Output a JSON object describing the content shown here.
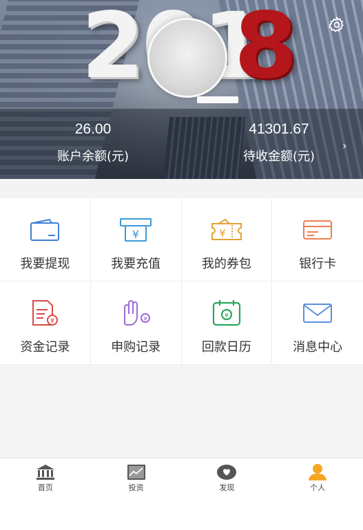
{
  "banner": {
    "year_text": "201",
    "year_accent": "8"
  },
  "account": {
    "balance_value": "26.00",
    "balance_label": "账户余额(元)",
    "pending_value": "41301.67",
    "pending_label": "待收金额(元)"
  },
  "menu": [
    {
      "label": "我要提现",
      "icon": "wallet-icon",
      "color": "#3d7fd6"
    },
    {
      "label": "我要充值",
      "icon": "atm-icon",
      "color": "#3a9ad9"
    },
    {
      "label": "我的券包",
      "icon": "coupon-icon",
      "color": "#e2a23a"
    },
    {
      "label": "银行卡",
      "icon": "bank-card-icon",
      "color": "#ee7e4e"
    },
    {
      "label": "资金记录",
      "icon": "fund-record-icon",
      "color": "#d94848"
    },
    {
      "label": "申购记录",
      "icon": "hand-coin-icon",
      "color": "#9b6bd6"
    },
    {
      "label": "回款日历",
      "icon": "calendar-icon",
      "color": "#2aa55e"
    },
    {
      "label": "消息中心",
      "icon": "mail-icon",
      "color": "#5a8fe0"
    }
  ],
  "tabs": [
    {
      "label": "首页",
      "icon": "bank-building-icon"
    },
    {
      "label": "投资",
      "icon": "chart-icon"
    },
    {
      "label": "发现",
      "icon": "discover-icon"
    },
    {
      "label": "个人",
      "icon": "person-icon",
      "active": true
    }
  ],
  "colors": {
    "accent_orange": "#f5a623",
    "text_dark": "#333333"
  }
}
